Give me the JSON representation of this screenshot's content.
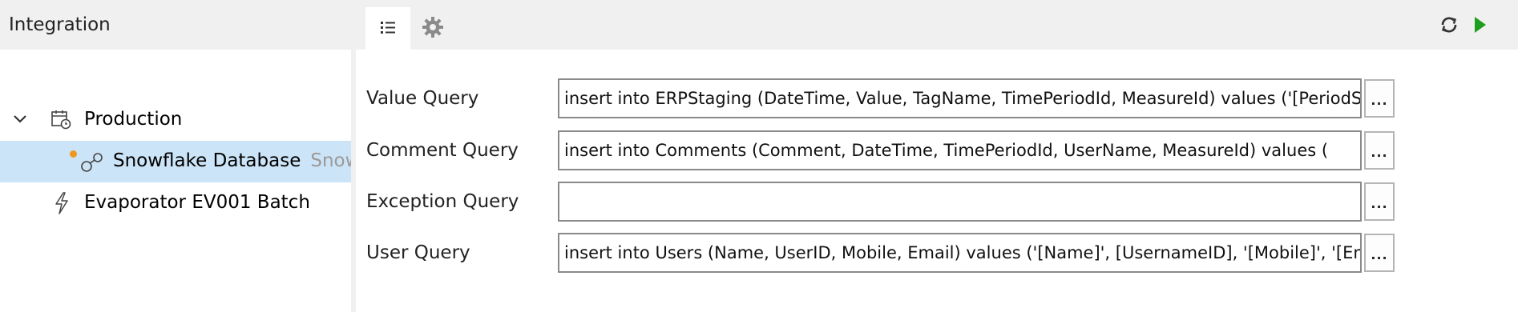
{
  "panel": {
    "title": "Integration"
  },
  "tree": {
    "nodes": [
      {
        "label": "Production",
        "icon": "calendar-clock-icon",
        "expanded": true
      },
      {
        "label": "Snowflake Database",
        "type_text": "Snowflake",
        "icon": "connection-icon",
        "modified": true,
        "selected": true
      },
      {
        "label": "Evaporator EV001 Batch",
        "icon": "lightning-icon"
      }
    ]
  },
  "toolbar": {
    "tabs": [
      {
        "name": "list",
        "icon": "list-icon",
        "active": true
      },
      {
        "name": "settings",
        "icon": "gear-icon",
        "active": false
      }
    ],
    "actions": [
      {
        "icon": "refresh-icon"
      },
      {
        "icon": "play-icon"
      }
    ]
  },
  "form": {
    "rows": [
      {
        "label": "Value Query",
        "value": "insert into ERPStaging (DateTime, Value, TagName, TimePeriodId, MeasureId) values ('[PeriodStart]'",
        "button": "..."
      },
      {
        "label": "Comment Query",
        "value": "insert into Comments (Comment, DateTime, TimePeriodId, UserName, MeasureId) values (",
        "button": "..."
      },
      {
        "label": "Exception Query",
        "value": "",
        "button": "..."
      },
      {
        "label": "User Query",
        "value": "insert into Users (Name, UserID, Mobile, Email) values ('[Name]', [UsernameID], '[Mobile]', '[Email]')",
        "button": "..."
      }
    ]
  },
  "colors": {
    "accent_dot": "#f0961e",
    "selection": "#cce4f7",
    "play": "#1e9e1e"
  }
}
